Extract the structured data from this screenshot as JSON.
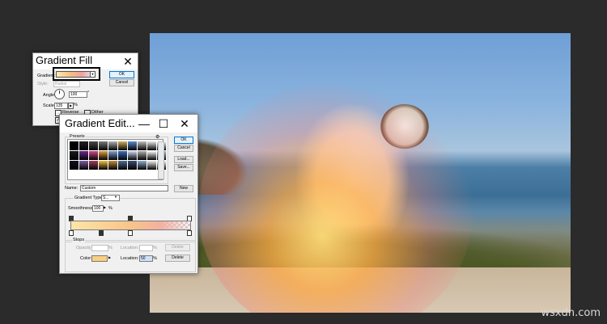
{
  "photo": {
    "description_icon": "photo-canvas"
  },
  "watermark": "wsxdn.com",
  "gradient_fill": {
    "title": "Gradient Fill",
    "gradient_label": "Gradient:",
    "style_label": "Style:",
    "style_value": "Radial",
    "angle_label": "Angle:",
    "angle_value": "100",
    "angle_unit": "°",
    "scale_label": "Scale:",
    "scale_value": "135",
    "scale_unit": "%",
    "reverse_label": "Reverse",
    "dither_label": "Dither",
    "ok_label": "OK",
    "cancel_label": "Cancel"
  },
  "gradient_editor": {
    "title": "Gradient Edit...",
    "presets_label": "Presets",
    "ok_label": "OK",
    "cancel_label": "Cancel",
    "load_label": "Load...",
    "save_label": "Save...",
    "name_label": "Name:",
    "name_value": "Custom",
    "new_label": "New",
    "gradient_type_label": "Gradient Type:",
    "gradient_type_value": "S...",
    "smoothness_label": "Smoothness:",
    "smoothness_value": "100",
    "smoothness_unit": "%",
    "stops_label": "Stops",
    "opacity_label": "Opacity:",
    "opacity_unit": "%",
    "location_label": "Location:",
    "location_unit": "%",
    "delete_label": "Delete",
    "color_label": "Color:",
    "color_location_label": "Location:",
    "color_location_value": "50",
    "color_location_unit": "%",
    "color_delete_label": "Delete",
    "preset_colors": [
      "#000000",
      "#202020",
      "#4a4a4a",
      "#7a7a7a",
      "#b0b0b0",
      "#d0b060",
      "#5a8fd0",
      "#c0c0c0",
      "#e8e8e8",
      "#ffffff",
      "#1a1a1a",
      "#6a2a8a",
      "#d04a8a",
      "#e0a040",
      "#80a0d0",
      "#3a70c0",
      "#d0d8f0",
      "#b0b0b0",
      "#fafafa",
      "#a0c8e8",
      "#101020",
      "#8060a0",
      "#a04060",
      "#f0c040",
      "#c09040",
      "#507090",
      "#405070",
      "#90b0d0",
      "#f0f0f0",
      "#ffffff"
    ]
  }
}
